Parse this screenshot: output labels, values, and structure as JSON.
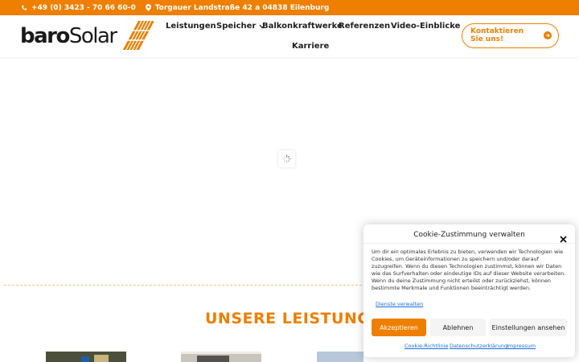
{
  "topbar": {
    "phone": "+49 (0) 3423 - 70 66 60-0",
    "address": "Torgauer Landstraße 42 a 04838 Eilenburg"
  },
  "logo": {
    "part1": "baro",
    "part2": "Solar"
  },
  "nav": {
    "items": [
      "Leistungen",
      "Speicher",
      "Balkonkraftwerke",
      "Referenzen",
      "Video-Einblicke",
      "Karriere"
    ]
  },
  "cta": {
    "label": "Kontaktieren Sie uns!"
  },
  "section": {
    "title": "UNSERE LEISTUNGEN"
  },
  "cookie": {
    "title": "Cookie-Zustimmung verwalten",
    "body": "Um dir ein optimales Erlebnis zu bieten, verwenden wir Technologien wie Cookies, um Geräteinformationen zu speichern und/oder darauf zuzugreifen. Wenn du diesen Technologien zustimmst, können wir Daten wie das Surfverhalten oder eindeutige IDs auf dieser Website verarbeiten. Wenn du deine Zustimmung nicht erteilst oder zurückziehst, können bestimmte Merkmale und Funktionen beeinträchtigt werden.",
    "services_link": "Dienste verwalten",
    "accept": "Akzeptieren",
    "deny": "Ablehnen",
    "settings": "Einstellungen ansehen",
    "footer_links": [
      "Cookie-Richtlinie",
      "Datenschutzerklärung",
      "Impressum"
    ]
  },
  "colors": {
    "accent": "#ee7f00",
    "link": "#1a6ed8"
  },
  "icons": [
    "phone-icon",
    "location-icon",
    "chevron-down-icon",
    "arrow-right-icon",
    "close-icon",
    "loading-spinner-icon",
    "logo-solar-panel-icon"
  ]
}
